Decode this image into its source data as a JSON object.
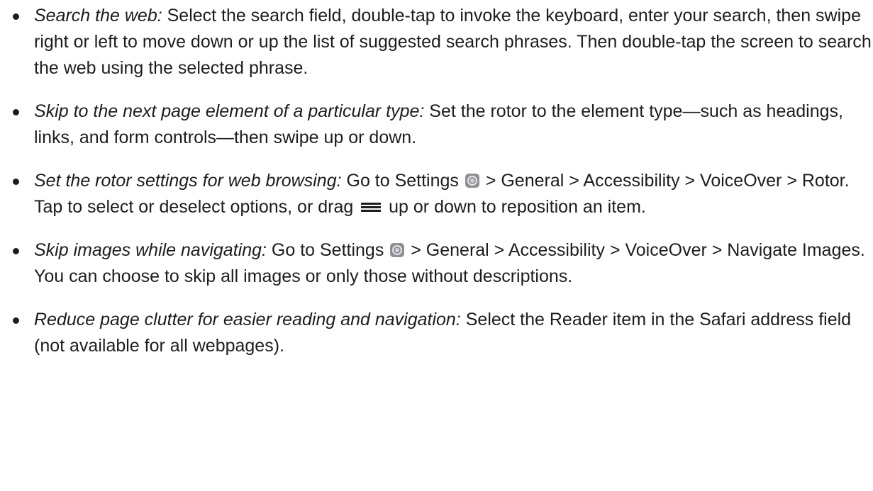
{
  "items": [
    {
      "lead": "Search the web:",
      "text": " Select the search field, double-tap to invoke the keyboard, enter your search, then swipe right or left to move down or up the list of suggested search phrases. Then double-tap the screen to search the web using the selected phrase."
    },
    {
      "lead": "Skip to the next page element of a particular type:",
      "text": " Set the rotor to the element type—such as headings, links, and form controls—then swipe up or down."
    },
    {
      "lead": "Set the rotor settings for web browsing:",
      "text_a": " Go to Settings ",
      "text_b": " > General > Accessibility > VoiceOver > Rotor. Tap to select or deselect options, or drag ",
      "text_c": " up or down to reposition an item."
    },
    {
      "lead": "Skip images while navigating:",
      "text_a": " Go to Settings ",
      "text_b": " > General > Accessibility > VoiceOver > Navigate Images. You can choose to skip all images or only those without descriptions."
    },
    {
      "lead": "Reduce page clutter for easier reading and navigation:",
      "text": " Select the Reader item in the Safari address field (not available for all webpages)."
    }
  ],
  "icons": {
    "settings": "settings-gear-icon",
    "reorder": "reorder-handle-icon"
  }
}
